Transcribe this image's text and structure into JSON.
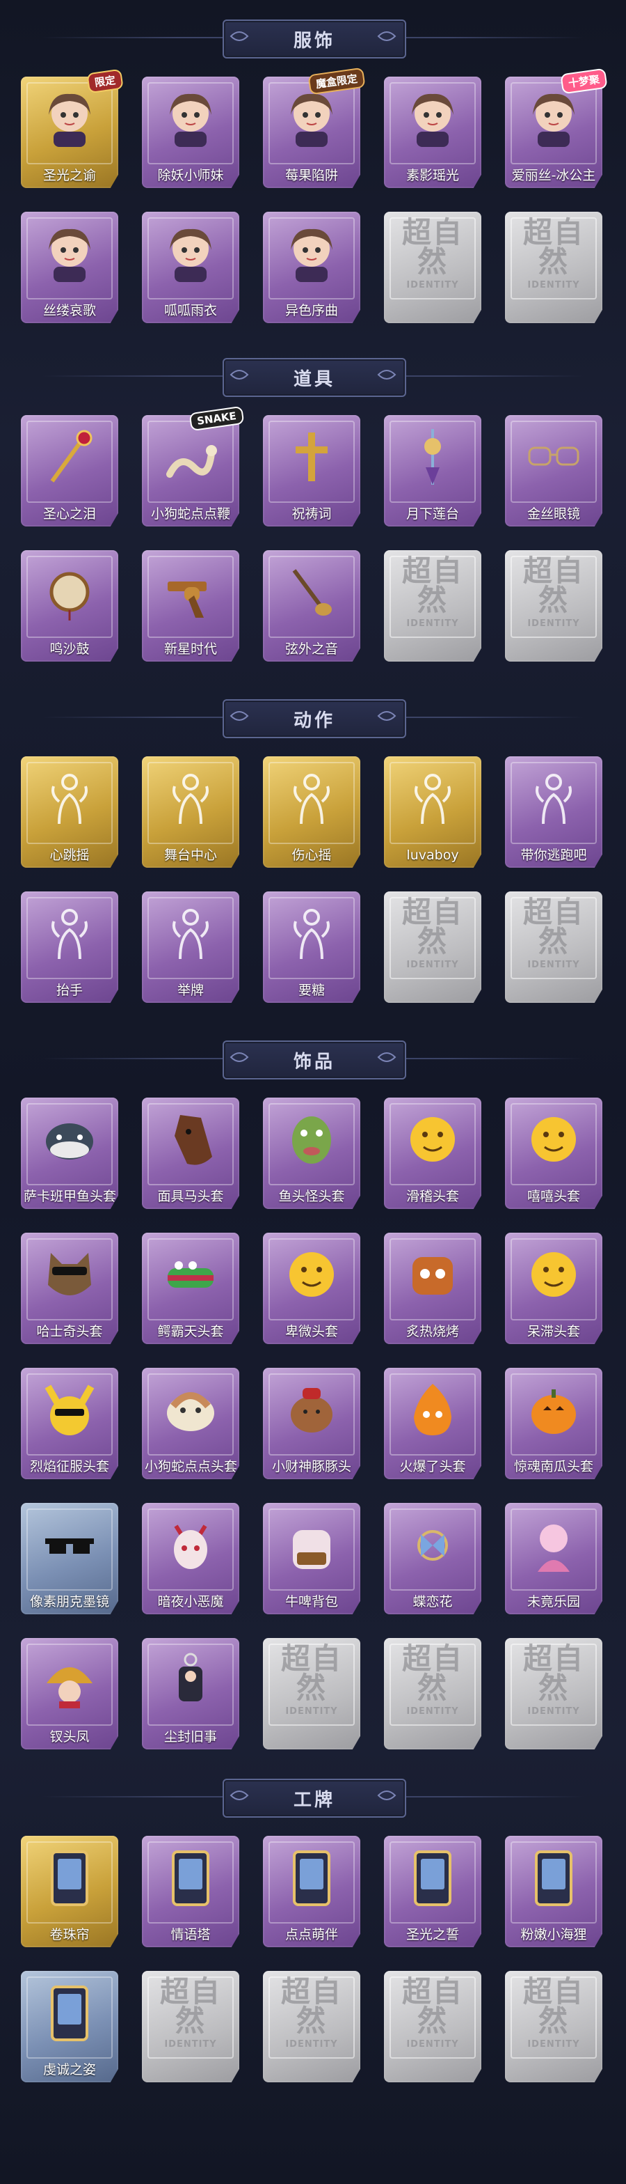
{
  "sections": [
    {
      "title": "服饰",
      "items": [
        {
          "label": "圣光之谕",
          "style": "gold",
          "icon": "character-portrait-icon",
          "badge": "限定",
          "badge_style": "red"
        },
        {
          "label": "除妖小师妹",
          "style": "purple",
          "icon": "character-portrait-icon",
          "badge": "",
          "badge_style": ""
        },
        {
          "label": "莓果陷阱",
          "style": "purple",
          "icon": "character-portrait-icon",
          "badge": "魔盒限定",
          "badge_style": "brown"
        },
        {
          "label": "素影瑶光",
          "style": "purple",
          "icon": "character-portrait-icon",
          "badge": "",
          "badge_style": ""
        },
        {
          "label": "爱丽丝-冰公主",
          "style": "purple",
          "icon": "character-portrait-icon",
          "badge": "十梦聚",
          "badge_style": "pink"
        },
        {
          "label": "丝缕哀歌",
          "style": "purple",
          "icon": "character-portrait-icon",
          "badge": "",
          "badge_style": ""
        },
        {
          "label": "呱呱雨衣",
          "style": "purple",
          "icon": "character-portrait-icon",
          "badge": "",
          "badge_style": ""
        },
        {
          "label": "异色序曲",
          "style": "purple",
          "icon": "character-portrait-icon",
          "badge": "",
          "badge_style": ""
        },
        {
          "label": "",
          "style": "gray",
          "icon": "placeholder-icon",
          "badge": "",
          "badge_style": ""
        },
        {
          "label": "",
          "style": "gray",
          "icon": "placeholder-icon",
          "badge": "",
          "badge_style": ""
        }
      ]
    },
    {
      "title": "道具",
      "items": [
        {
          "label": "圣心之泪",
          "style": "purple",
          "icon": "scepter-icon",
          "badge": "",
          "badge_style": ""
        },
        {
          "label": "小狗蛇点点鞭",
          "style": "purple",
          "icon": "snake-whip-icon",
          "badge": "SNAKE",
          "badge_style": "dark"
        },
        {
          "label": "祝祷词",
          "style": "purple",
          "icon": "cross-icon",
          "badge": "",
          "badge_style": ""
        },
        {
          "label": "月下莲台",
          "style": "purple",
          "icon": "lantern-icon",
          "badge": "",
          "badge_style": ""
        },
        {
          "label": "金丝眼镜",
          "style": "purple",
          "icon": "glasses-icon",
          "badge": "",
          "badge_style": ""
        },
        {
          "label": "鸣沙鼓",
          "style": "purple",
          "icon": "drum-icon",
          "badge": "",
          "badge_style": ""
        },
        {
          "label": "新星时代",
          "style": "purple",
          "icon": "revolver-icon",
          "badge": "",
          "badge_style": ""
        },
        {
          "label": "弦外之音",
          "style": "purple",
          "icon": "instrument-icon",
          "badge": "",
          "badge_style": ""
        },
        {
          "label": "",
          "style": "gray",
          "icon": "placeholder-icon",
          "badge": "",
          "badge_style": ""
        },
        {
          "label": "",
          "style": "gray",
          "icon": "placeholder-icon",
          "badge": "",
          "badge_style": ""
        }
      ]
    },
    {
      "title": "动作",
      "items": [
        {
          "label": "心跳摇",
          "style": "gold",
          "icon": "gesture-icon",
          "badge": "",
          "badge_style": ""
        },
        {
          "label": "舞台中心",
          "style": "gold",
          "icon": "gesture-icon",
          "badge": "",
          "badge_style": ""
        },
        {
          "label": "伤心摇",
          "style": "gold",
          "icon": "gesture-icon",
          "badge": "",
          "badge_style": ""
        },
        {
          "label": "luvaboy",
          "style": "gold",
          "icon": "gesture-icon",
          "badge": "",
          "badge_style": ""
        },
        {
          "label": "带你逃跑吧",
          "style": "purple",
          "icon": "gesture-icon",
          "badge": "",
          "badge_style": ""
        },
        {
          "label": "抬手",
          "style": "purple",
          "icon": "gesture-icon",
          "badge": "",
          "badge_style": ""
        },
        {
          "label": "举牌",
          "style": "purple",
          "icon": "gesture-icon",
          "badge": "",
          "badge_style": ""
        },
        {
          "label": "要糖",
          "style": "purple",
          "icon": "gesture-icon",
          "badge": "",
          "badge_style": ""
        },
        {
          "label": "",
          "style": "gray",
          "icon": "placeholder-icon",
          "badge": "",
          "badge_style": ""
        },
        {
          "label": "",
          "style": "gray",
          "icon": "placeholder-icon",
          "badge": "",
          "badge_style": ""
        }
      ]
    },
    {
      "title": "饰品",
      "items": [
        {
          "label": "萨卡班甲鱼头套",
          "style": "purple",
          "icon": "fish-head-icon",
          "badge": "",
          "badge_style": ""
        },
        {
          "label": "面具马头套",
          "style": "purple",
          "icon": "horse-head-icon",
          "badge": "",
          "badge_style": ""
        },
        {
          "label": "鱼头怪头套",
          "style": "purple",
          "icon": "fish-monster-icon",
          "badge": "",
          "badge_style": ""
        },
        {
          "label": "滑稽头套",
          "style": "purple",
          "icon": "emoji-face-icon",
          "badge": "",
          "badge_style": ""
        },
        {
          "label": "嘻嘻头套",
          "style": "purple",
          "icon": "emoji-face-icon",
          "badge": "",
          "badge_style": ""
        },
        {
          "label": "哈士奇头套",
          "style": "purple",
          "icon": "dog-head-icon",
          "badge": "",
          "badge_style": ""
        },
        {
          "label": "鳄霸天头套",
          "style": "purple",
          "icon": "crocodile-head-icon",
          "badge": "",
          "badge_style": ""
        },
        {
          "label": "卑微头套",
          "style": "purple",
          "icon": "emoji-face-icon",
          "badge": "",
          "badge_style": ""
        },
        {
          "label": "炙热烧烤",
          "style": "purple",
          "icon": "toast-head-icon",
          "badge": "",
          "badge_style": ""
        },
        {
          "label": "呆滞头套",
          "style": "purple",
          "icon": "emoji-face-icon",
          "badge": "",
          "badge_style": ""
        },
        {
          "label": "烈焰征服头套",
          "style": "purple",
          "icon": "pikachu-head-icon",
          "badge": "",
          "badge_style": ""
        },
        {
          "label": "小狗蛇点点头套",
          "style": "purple",
          "icon": "snake-head-icon",
          "badge": "",
          "badge_style": ""
        },
        {
          "label": "小财神豚豚头",
          "style": "purple",
          "icon": "capybara-head-icon",
          "badge": "",
          "badge_style": ""
        },
        {
          "label": "火爆了头套",
          "style": "purple",
          "icon": "fire-head-icon",
          "badge": "",
          "badge_style": ""
        },
        {
          "label": "惊魂南瓜头套",
          "style": "purple",
          "icon": "pumpkin-head-icon",
          "badge": "",
          "badge_style": ""
        },
        {
          "label": "像素朋克墨镜",
          "style": "blue",
          "icon": "pixel-glasses-icon",
          "badge": "",
          "badge_style": ""
        },
        {
          "label": "暗夜小恶魔",
          "style": "purple",
          "icon": "devil-mask-icon",
          "badge": "",
          "badge_style": ""
        },
        {
          "label": "牛啤背包",
          "style": "purple",
          "icon": "backpack-icon",
          "badge": "",
          "badge_style": ""
        },
        {
          "label": "蝶恋花",
          "style": "purple",
          "icon": "butterfly-ornament-icon",
          "badge": "",
          "badge_style": ""
        },
        {
          "label": "未竟乐园",
          "style": "purple",
          "icon": "doll-icon",
          "badge": "",
          "badge_style": ""
        },
        {
          "label": "钗头凤",
          "style": "purple",
          "icon": "headdress-icon",
          "badge": "",
          "badge_style": ""
        },
        {
          "label": "尘封旧事",
          "style": "purple",
          "icon": "keychain-icon",
          "badge": "",
          "badge_style": ""
        },
        {
          "label": "",
          "style": "gray",
          "icon": "placeholder-icon",
          "badge": "",
          "badge_style": ""
        },
        {
          "label": "",
          "style": "gray",
          "icon": "placeholder-icon",
          "badge": "",
          "badge_style": ""
        },
        {
          "label": "",
          "style": "gray",
          "icon": "placeholder-icon",
          "badge": "",
          "badge_style": ""
        }
      ]
    },
    {
      "title": "工牌",
      "items": [
        {
          "label": "卷珠帘",
          "style": "gold",
          "icon": "badge-card-icon",
          "badge": "",
          "badge_style": ""
        },
        {
          "label": "情语塔",
          "style": "purple",
          "icon": "badge-card-icon",
          "badge": "",
          "badge_style": ""
        },
        {
          "label": "点点萌伴",
          "style": "purple",
          "icon": "badge-card-icon",
          "badge": "",
          "badge_style": ""
        },
        {
          "label": "圣光之誓",
          "style": "purple",
          "icon": "badge-card-icon",
          "badge": "",
          "badge_style": ""
        },
        {
          "label": "粉嫩小海狸",
          "style": "purple",
          "icon": "badge-card-icon",
          "badge": "",
          "badge_style": ""
        },
        {
          "label": "虔诚之姿",
          "style": "blue",
          "icon": "badge-card-icon",
          "badge": "",
          "badge_style": ""
        },
        {
          "label": "",
          "style": "gray",
          "icon": "placeholder-icon",
          "badge": "",
          "badge_style": ""
        },
        {
          "label": "",
          "style": "gray",
          "icon": "placeholder-icon",
          "badge": "",
          "badge_style": ""
        },
        {
          "label": "",
          "style": "gray",
          "icon": "placeholder-icon",
          "badge": "",
          "badge_style": ""
        },
        {
          "label": "",
          "style": "gray",
          "icon": "placeholder-icon",
          "badge": "",
          "badge_style": ""
        }
      ]
    }
  ],
  "placeholder": {
    "text": "超自然",
    "sub": "IDENTITY"
  },
  "colors": {
    "background": "#141827",
    "purple": "#8c62ad",
    "gold": "#c9a13a",
    "blue": "#7b90b4",
    "gray": "#bcbcbf"
  }
}
